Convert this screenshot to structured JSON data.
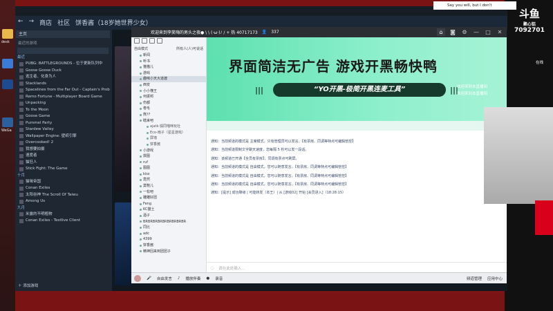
{
  "steam": {
    "nav_items": [
      "商店",
      "社区",
      "饼香酱（18岁她世界少女）"
    ],
    "home_label": "主页",
    "recent_games_label": "最近的游戏",
    "games_section_label": "最近",
    "games": [
      "PUBG: BATTLEGROUNDS - 位于更新队列中",
      "Goose Goose Duck",
      "逃生者、化身为人",
      "Stacklands",
      "Spacelines from the Far Out - Captain's Prob",
      "Remo Fortune - Multiplayer Board Game",
      "Unpacking",
      "To the Moon",
      "Goose Game",
      "Pummel Party",
      "Stardew Valley",
      "Wallpaper Engine: 壁纸引擎",
      "Overcooked! 2",
      "我想要拍摄",
      "速度者",
      "猫狂人",
      "Stick Fight: The Game"
    ],
    "category2_label": "十月",
    "games2": [
      "猫咪帝国",
      "Conan Exiles",
      "太阳谷神 The Scroll Of Taiwu",
      "Among Us"
    ],
    "category3_label": "九月",
    "games3": [
      "米露的不明植物",
      "Conan Exiles - Testlive Client"
    ],
    "add_game_label": "添加游戏"
  },
  "chat": {
    "window_title": "欢迎来到李笑嗨的男头之夜● \\ \\ (·ω·)ﾉ / + 热 40717173",
    "user_count": "337",
    "mode_label": "自由模式",
    "mode_option": "所有人(人)可说话",
    "channels": [
      {
        "name": "新闻",
        "type": "channel"
      },
      {
        "name": "听书",
        "type": "channel"
      },
      {
        "name": "猫猫儿",
        "type": "channel"
      },
      {
        "name": "游戏",
        "type": "channel"
      },
      {
        "name": "趣味小天大道渡",
        "type": "channel",
        "selected": true
      },
      {
        "name": "西安",
        "type": "channel"
      },
      {
        "name": "小小懂王",
        "type": "channel"
      },
      {
        "name": "何振邦",
        "type": "channel"
      },
      {
        "name": "伤都",
        "type": "channel"
      },
      {
        "name": "卷毛",
        "type": "channel"
      },
      {
        "name": "熊??",
        "type": "channel"
      },
      {
        "name": "瞎来吧",
        "type": "channel"
      },
      {
        "name": "ajatk-狐同喵咪玩社",
        "type": "user"
      },
      {
        "name": "Eco-雨子（星星游戏）",
        "type": "user"
      },
      {
        "name": "屏墙",
        "type": "user"
      },
      {
        "name": "饼香酱",
        "type": "user"
      },
      {
        "name": "小游戏",
        "type": "channel"
      },
      {
        "name": "撰图",
        "type": "channel"
      },
      {
        "name": "ruf",
        "type": "channel"
      },
      {
        "name": "图图",
        "type": "channel"
      },
      {
        "name": "kiss",
        "type": "channel"
      },
      {
        "name": "竟然",
        "type": "channel"
      },
      {
        "name": "莫鞋儿",
        "type": "channel"
      },
      {
        "name": "一松吧",
        "type": "channel"
      },
      {
        "name": "雕雕好团",
        "type": "channel"
      },
      {
        "name": "Feng",
        "type": "channel"
      },
      {
        "name": "KC猫土",
        "type": "channel"
      },
      {
        "name": "酒子",
        "type": "channel"
      },
      {
        "name": "BRBRBRBRBRBRBRBRBR",
        "type": "channel"
      },
      {
        "name": "同比",
        "type": "channel"
      },
      {
        "name": "adc",
        "type": "channel"
      },
      {
        "name": "4399",
        "type": "channel"
      },
      {
        "name": "饼香酱",
        "type": "channel"
      },
      {
        "name": "精神回来到团团子",
        "type": "channel"
      }
    ],
    "banner_title": "界面简洁无广告 游戏开黑畅快鸭",
    "banner_slogan": "“YO开黑-极简开黑连麦工具”",
    "messages": [
      "通知：当前频道的模式是 主席模式，只有管理员可以发言。【有票房、同调等特点可编辑管控】",
      "通知：当前频道限制文字聊天速度，您每隔 5 秒可以发一段话。",
      "通知：该频道已开通【全员有票房】，同调有票点可刷屏。",
      "通知：当前频道的模式是 自由模式，您可以随意发言。【有票房、同调等特点可编辑管控】",
      "通知：当前频道的模式是 自由模式，您可以随意发言。【有票房、同调等特点可编辑管控】",
      "通知：当前频道的模式是 自由模式，您可以随意发言。【有票房、同调等特点可编辑管控】",
      "通知：[提示] 成功降级 | 可能转发（本王）| 从 [游戏02] 开始 [会员进入]（18:28:15）"
    ],
    "input_placeholder": "请在此处输入...",
    "bottom_items": [
      "自由发言",
      "播放伴奏",
      "录音"
    ],
    "bottom_right": [
      "频道管理",
      "应用中心"
    ]
  },
  "overlay": {
    "logo_top": "斗鱼",
    "logo_mid": "聚心铝",
    "room_number": "7092701",
    "notice_text": "Say you will, but I don't",
    "side_notes": [
      "欢迎来到本直播间",
      "欢迎来到本直播间"
    ],
    "side_label": "在线"
  },
  "desktop": {
    "icons": [
      "desk",
      "WeGa"
    ]
  }
}
